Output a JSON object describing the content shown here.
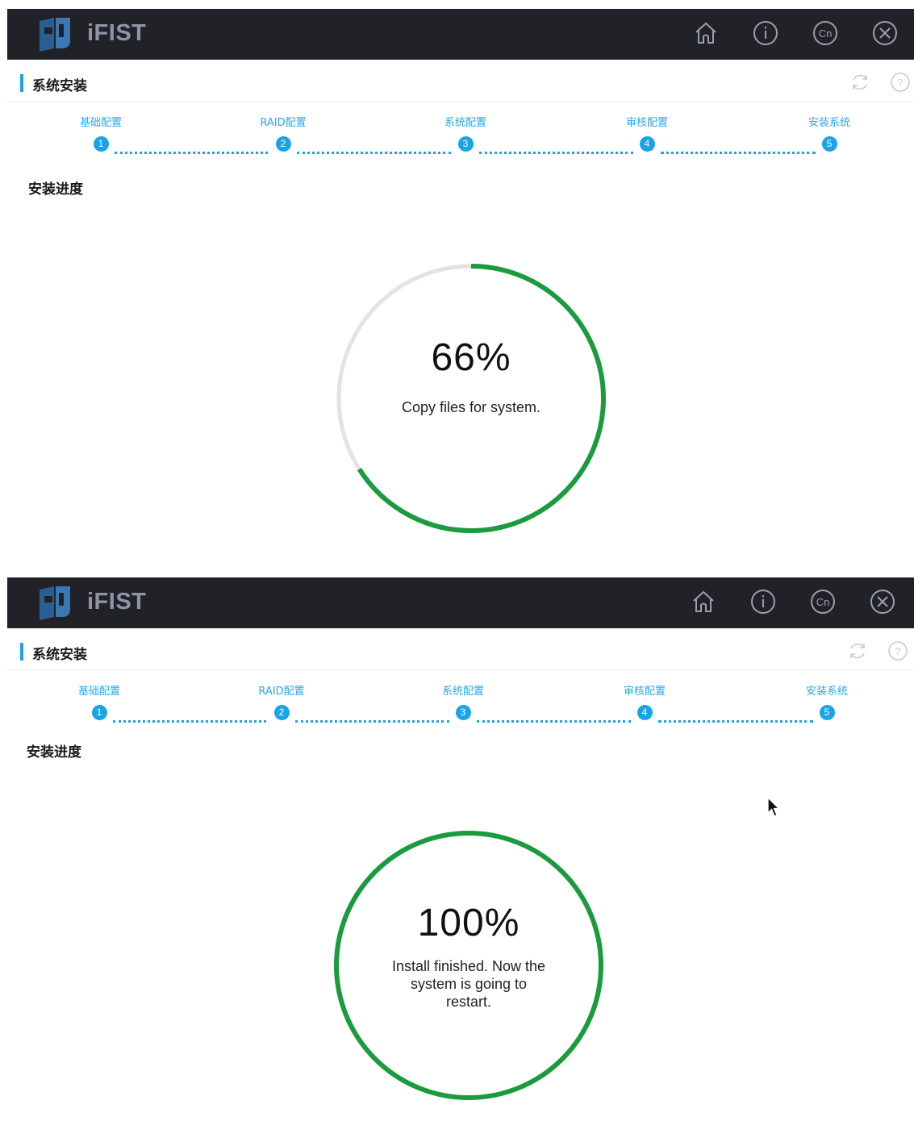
{
  "app": {
    "name": "iFIST"
  },
  "colors": {
    "titlebar": "#212227",
    "accent": "#1aa3e8",
    "progress": "#1a9c3e",
    "track": "#e3e3e3"
  },
  "titlebar_icons": [
    "home-icon",
    "info-icon",
    "language-cn-icon",
    "close-icon"
  ],
  "language_icon_text": "Cn",
  "section": {
    "title": "系统安装"
  },
  "header_icons": [
    "refresh-icon",
    "help-icon"
  ],
  "steps": [
    {
      "label": "基础配置",
      "number": "1"
    },
    {
      "label": "RAID配置",
      "number": "2"
    },
    {
      "label": "系统配置",
      "number": "3"
    },
    {
      "label": "审核配置",
      "number": "4"
    },
    {
      "label": "安装系统",
      "number": "5"
    }
  ],
  "progress_title": "安装进度",
  "screens": [
    {
      "percent_text": "66%",
      "percent_value": 66,
      "message": "Copy files for system."
    },
    {
      "percent_text": "100%",
      "percent_value": 100,
      "message": "Install finished. Now the system is going to restart."
    }
  ]
}
